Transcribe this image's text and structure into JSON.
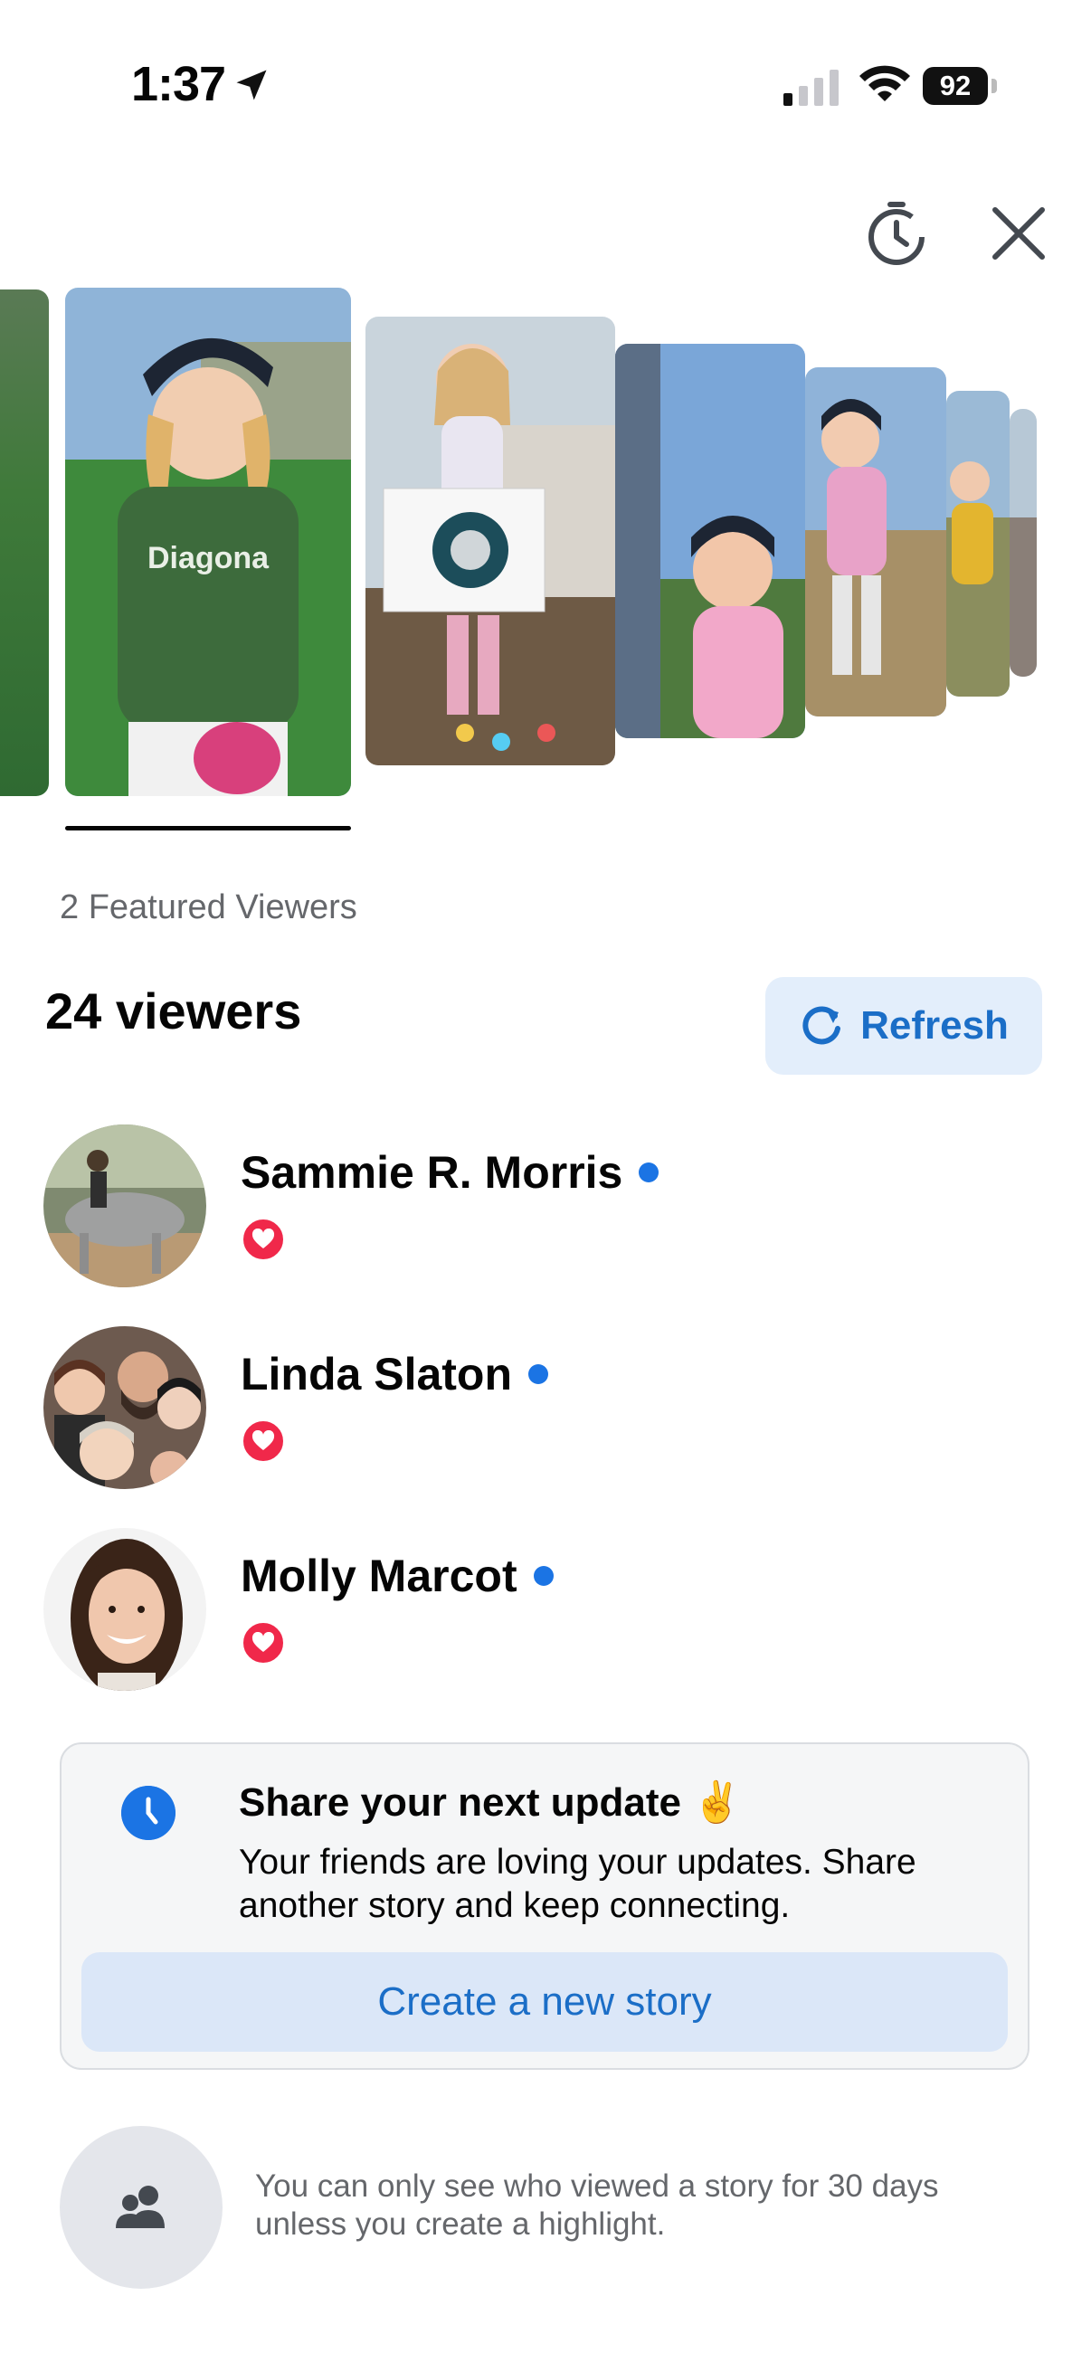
{
  "status_bar": {
    "time": "1:37",
    "battery": "92"
  },
  "header": {
    "history_icon": "story-history-icon",
    "close_icon": "close-icon"
  },
  "featured_label": "2 Featured Viewers",
  "viewers": {
    "count_label": "24 viewers",
    "refresh_label": "Refresh",
    "list": [
      {
        "name": "Sammie R. Morris",
        "reaction": "heart"
      },
      {
        "name": "Linda Slaton",
        "reaction": "heart"
      },
      {
        "name": "Molly Marcot",
        "reaction": "heart"
      }
    ]
  },
  "update_card": {
    "title": "Share your next update ✌️",
    "body": "Your friends are loving your updates. Share another story and keep connecting.",
    "button_label": "Create a new story"
  },
  "footer_note": "You can only see who viewed a story for 30 days unless you create a highlight.",
  "colors": {
    "accent": "#1b74e4",
    "heart": "#f0284a",
    "button_bg": "#e3eefb"
  }
}
